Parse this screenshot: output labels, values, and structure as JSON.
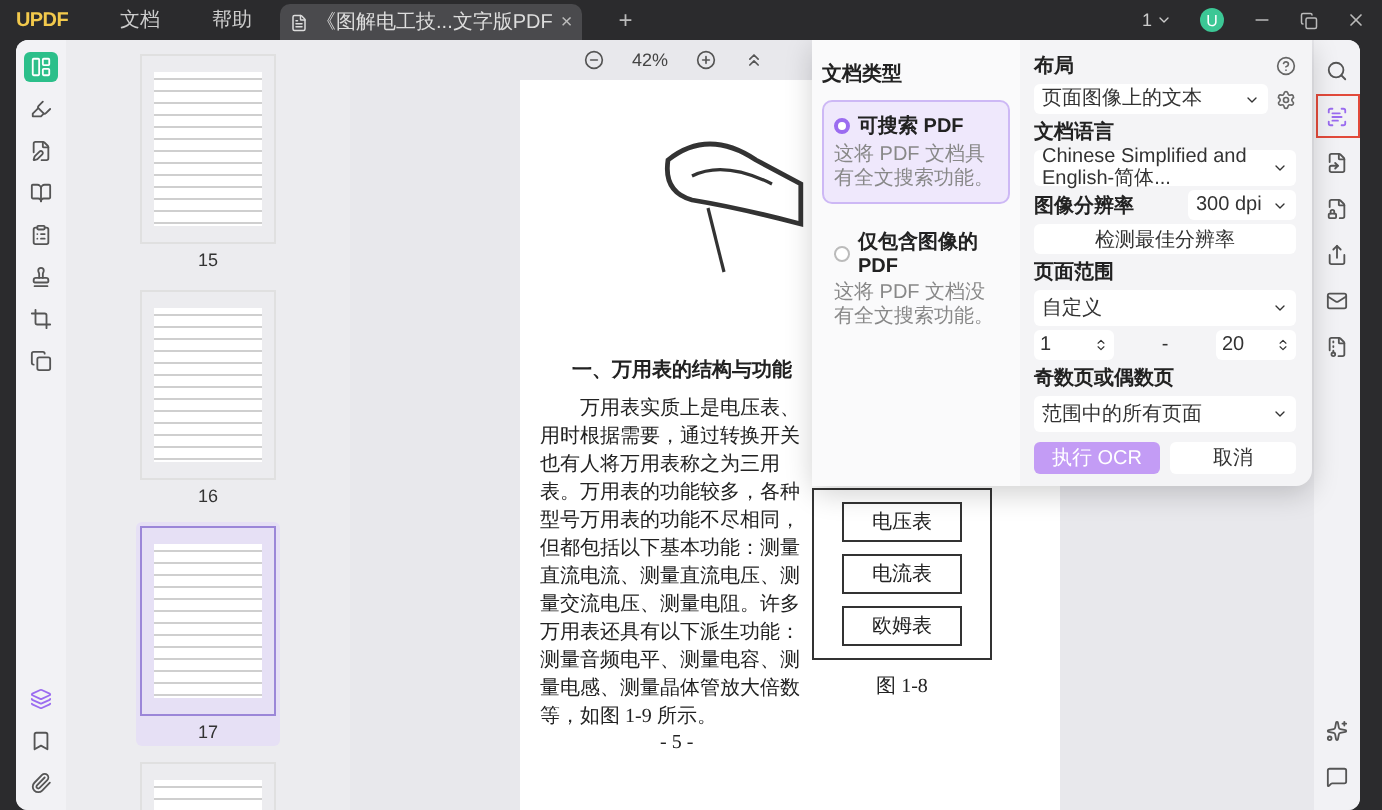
{
  "title_bar": {
    "logo": "UPDF",
    "menus": [
      "文档",
      "帮助"
    ],
    "tab": {
      "title": "《图解电工技...文字版PDF",
      "close": "×"
    },
    "new_tab": "+",
    "page_count": "1",
    "avatar": "U"
  },
  "left_rail": [
    {
      "kind": "thumbnails",
      "selected": true
    },
    {
      "kind": "comment",
      "selected": false
    },
    {
      "kind": "edit",
      "selected": false
    },
    {
      "kind": "organize",
      "selected": false
    },
    {
      "kind": "form",
      "selected": false
    },
    {
      "kind": "stamp",
      "selected": false
    },
    {
      "kind": "crop",
      "selected": false
    },
    {
      "kind": "copy",
      "selected": false
    }
  ],
  "left_rail_bottom": [
    {
      "kind": "layers",
      "selected": true
    },
    {
      "kind": "bookmark",
      "selected": false
    },
    {
      "kind": "attachment",
      "selected": false
    }
  ],
  "thumbnails": [
    {
      "label": "15",
      "selected": false
    },
    {
      "label": "16",
      "selected": false
    },
    {
      "label": "17",
      "selected": true
    },
    {
      "selected": false
    }
  ],
  "zoom": {
    "value": "42%"
  },
  "document": {
    "heading": "一、万用表的结构与功能",
    "lines": [
      "万用表实质上是电压表、",
      "用时根据需要，通过转换开关",
      "也有人将万用表称之为三用",
      "表。万用表的功能较多，各种",
      "型号万用表的功能不尽相同，",
      "但都包括以下基本功能：测量",
      "直流电流、测量直流电压、测",
      "量交流电压、测量电阻。许多",
      "万用表还具有以下派生功能：",
      "测量音频电平、测量电容、测",
      "量电感、测量晶体管放大倍数",
      "等，如图 1-9 所示。"
    ],
    "figure": {
      "boxes": [
        "电压表",
        "电流表",
        "欧姆表"
      ],
      "caption": "图 1-8"
    },
    "page_number": "- 5 -"
  },
  "ocr_panel": {
    "type_label": "文档类型",
    "types": [
      {
        "title": "可搜索 PDF",
        "description": "这将 PDF 文档具有全文搜索功能。",
        "selected": true
      },
      {
        "title": "仅包含图像的 PDF",
        "description": "这将 PDF 文档没有全文搜索功能。",
        "selected": false
      }
    ],
    "layout_label": "布局",
    "layout_value": "页面图像上的文本",
    "language_label": "文档语言",
    "language_value": "Chinese Simplified and English-简体...",
    "resolution_label": "图像分辨率",
    "resolution_value": "300 dpi",
    "detect_button": "检测最佳分辨率",
    "range_label": "页面范围",
    "range_value": "自定义",
    "range_from": "1",
    "range_separator": "-",
    "range_to": "20",
    "parity_label": "奇数页或偶数页",
    "parity_value": "范围中的所有页面",
    "run_button": "执行 OCR",
    "cancel_button": "取消"
  },
  "right_rail": [
    {
      "kind": "search",
      "selected": false
    },
    {
      "kind": "ocr",
      "selected": true
    },
    {
      "kind": "convert",
      "selected": false
    },
    {
      "kind": "protect",
      "selected": false
    },
    {
      "kind": "share",
      "selected": false
    },
    {
      "kind": "mail",
      "selected": false
    },
    {
      "kind": "compress",
      "selected": false
    }
  ],
  "right_rail_bottom": [
    {
      "kind": "ai",
      "selected": false
    },
    {
      "kind": "comment",
      "selected": false
    }
  ]
}
